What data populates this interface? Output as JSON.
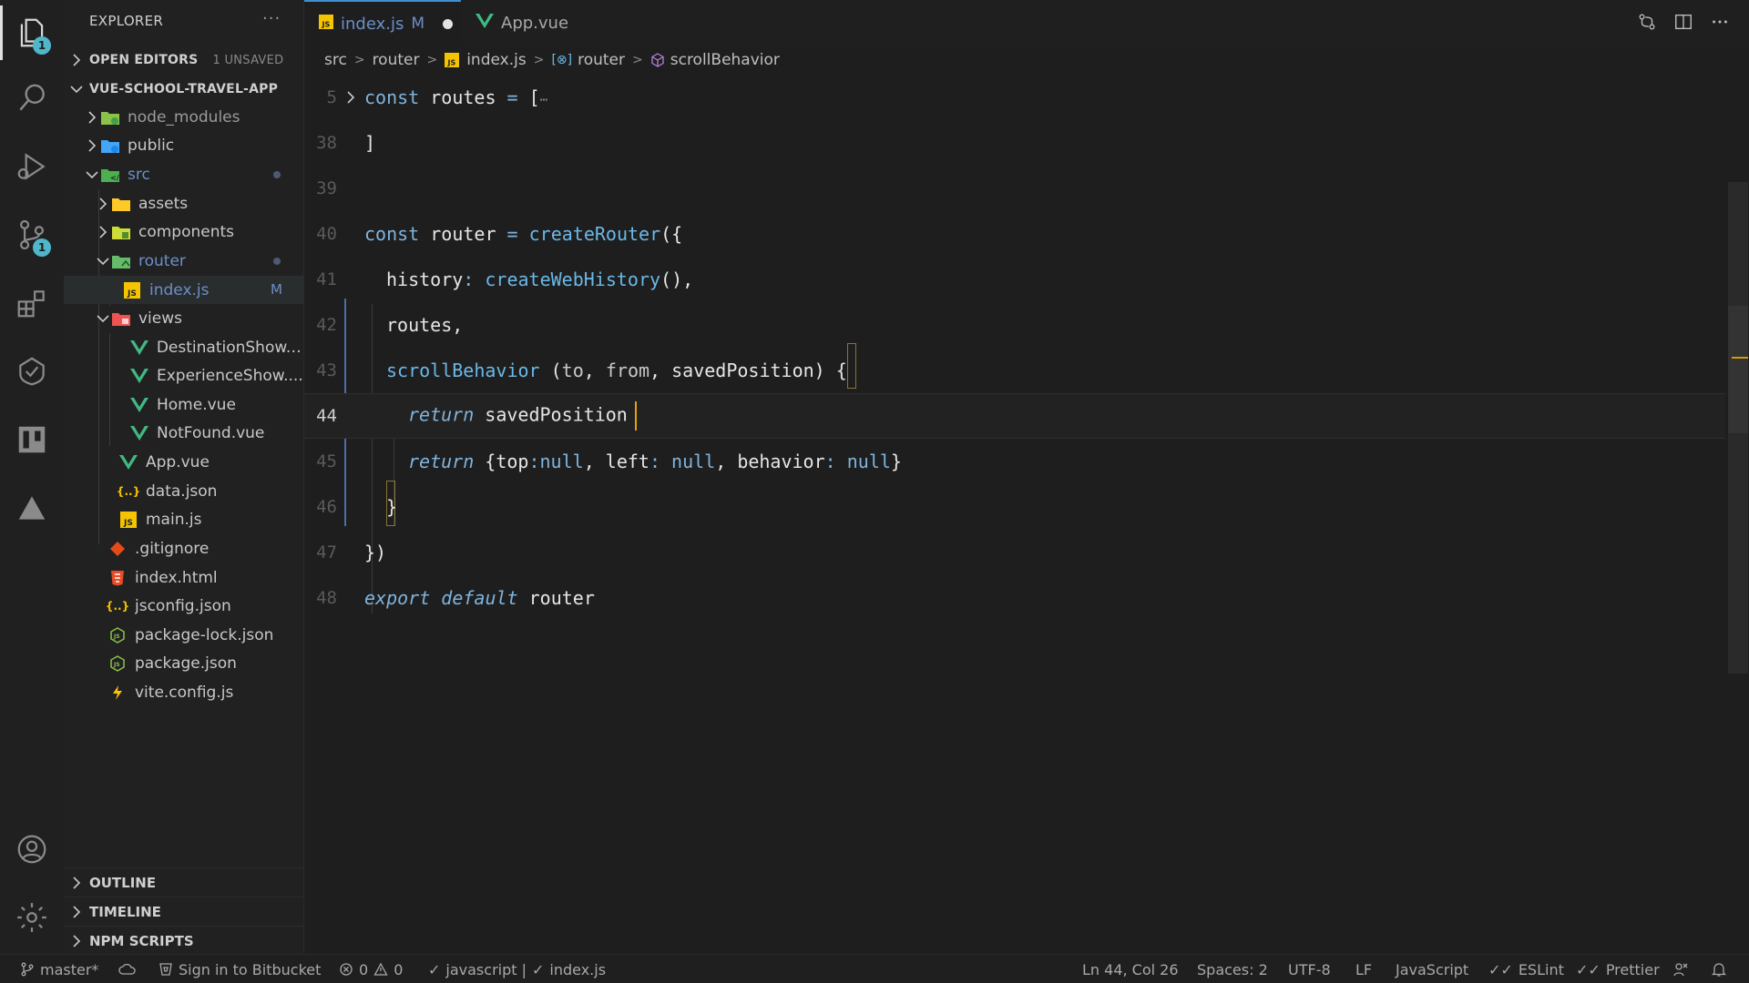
{
  "activity": {
    "explorer_badge": "1",
    "scm_badge": "1"
  },
  "explorer": {
    "title": "EXPLORER",
    "more": "···",
    "open_editors": "OPEN EDITORS",
    "unsaved": "1 UNSAVED",
    "project": "VUE-SCHOOL-TRAVEL-APP",
    "tree": [
      {
        "name": "node_modules"
      },
      {
        "name": "public"
      },
      {
        "name": "src"
      },
      {
        "name": "assets"
      },
      {
        "name": "components"
      },
      {
        "name": "router"
      },
      {
        "name": "index.js",
        "mark": "M"
      },
      {
        "name": "views"
      },
      {
        "name": "DestinationShow...."
      },
      {
        "name": "ExperienceShow...."
      },
      {
        "name": "Home.vue"
      },
      {
        "name": "NotFound.vue"
      },
      {
        "name": "App.vue"
      },
      {
        "name": "data.json"
      },
      {
        "name": "main.js"
      },
      {
        "name": ".gitignore"
      },
      {
        "name": "index.html"
      },
      {
        "name": "jsconfig.json"
      },
      {
        "name": "package-lock.json"
      },
      {
        "name": "package.json"
      },
      {
        "name": "vite.config.js"
      }
    ],
    "outline": "OUTLINE",
    "timeline": "TIMELINE",
    "npm_scripts": "NPM SCRIPTS"
  },
  "tabs": [
    {
      "name": "index.js",
      "modified": "M"
    },
    {
      "name": "App.vue"
    }
  ],
  "breadcrumb": {
    "src": "src",
    "router": "router",
    "file": "index.js",
    "symbol1": "router",
    "symbol2": "scrollBehavior"
  },
  "editor": {
    "lines": [
      {
        "n": "5"
      },
      {
        "n": "38"
      },
      {
        "n": "39"
      },
      {
        "n": "40"
      },
      {
        "n": "41"
      },
      {
        "n": "42"
      },
      {
        "n": "43"
      },
      {
        "n": "44"
      },
      {
        "n": "45"
      },
      {
        "n": "46"
      },
      {
        "n": "47"
      },
      {
        "n": "48"
      }
    ],
    "t": {
      "const": "const",
      "routes": "routes",
      "eq": " = ",
      "open_bracket": "[",
      "ellipsis": "⋯",
      "close_bracket": "]",
      "router": "router",
      "createRouter": "createRouter",
      "paren_brace": "({",
      "history": "history",
      "colon": ": ",
      "createWebHistory": "createWebHistory",
      "call_comma": "(),",
      "routes_comma": "routes,",
      "scrollBehavior": "scrollBehavior",
      "open_paren": " (",
      "to": "to",
      "comma": ", ",
      "from": "from",
      "savedPosition": "savedPosition",
      "close_paren": ") ",
      "brace_open": "{",
      "return": "return",
      "obj_open": "{",
      "top": "top",
      "colon_tight": ":",
      "null": "null",
      "left": "left",
      "behavior": "behavior",
      "obj_close": "}",
      "brace_close": "}",
      "end": "})",
      "export": "export",
      "default": "default"
    }
  },
  "status": {
    "branch": "master*",
    "bitbucket": "Sign in to Bitbucket",
    "errors": "0",
    "warnings": "0",
    "lang_check": "javascript |",
    "file_check": "index.js",
    "position": "Ln 44, Col 26",
    "spaces": "Spaces: 2",
    "encoding": "UTF-8",
    "eol": "LF",
    "language": "JavaScript",
    "eslint": "ESLint",
    "prettier": "Prettier"
  },
  "colors": {
    "accent": "#3e8ed0",
    "keyword": "#7fb4de",
    "cursor": "#e4a400"
  }
}
